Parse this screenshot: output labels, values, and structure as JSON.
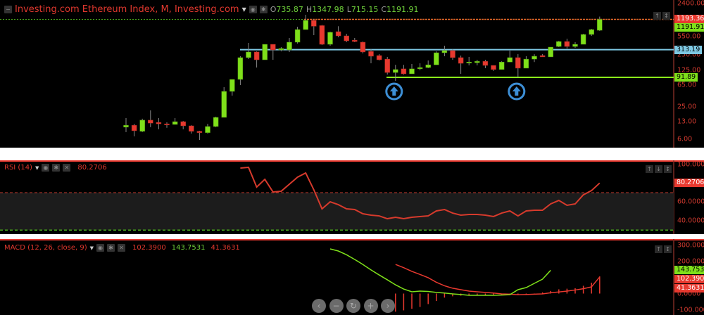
{
  "header": {
    "title": "Investing.com Ethereum Index, M, Investing.com",
    "o_label": "O",
    "o": "735.87",
    "h_label": "H",
    "h": "1347.98",
    "l_label": "L",
    "l": "715.15",
    "c_label": "C",
    "c": "1191.91"
  },
  "colors": {
    "up": "#7fe01a",
    "down": "#e8392f",
    "axis": "#d03a2f",
    "support": "#8cff1a",
    "resistance": "#7ec8e3",
    "arrow": "#3d8fd6"
  },
  "price_axis": {
    "ticks": [
      2400,
      550,
      250,
      125,
      65,
      25,
      13,
      6
    ],
    "tick_labels": [
      "2400.00",
      "550.00",
      "250.00",
      "125.00",
      "65.00",
      "25.00",
      "13.00",
      "6.00"
    ],
    "tags": [
      {
        "value": 1193.36,
        "text": "1193.36",
        "type": "red"
      },
      {
        "value": 1191.91,
        "text": "1191.91",
        "type": "green"
      },
      {
        "value": 313.19,
        "text": "313.19",
        "type": "blue"
      },
      {
        "value": 91.89,
        "text": "91.89",
        "type": "green"
      }
    ]
  },
  "levels": {
    "resistance": 313.19,
    "support": 91.89,
    "last": 1193.36
  },
  "candles": [
    [
      10.2,
      11.1,
      15.2,
      8.2
    ],
    [
      11.1,
      8.7,
      11.8,
      6.8
    ],
    [
      8.5,
      13.9,
      14.8,
      8.2
    ],
    [
      13.9,
      12.2,
      21.4,
      10.2
    ],
    [
      12.6,
      11.8,
      15.2,
      9.3
    ],
    [
      11.8,
      11.5,
      12.6,
      9.9
    ],
    [
      11.5,
      13.0,
      15.2,
      11.4
    ],
    [
      13.0,
      10.8,
      13.4,
      9.3
    ],
    [
      10.8,
      8.5,
      11.1,
      7.7
    ],
    [
      8.5,
      8.0,
      8.7,
      5.8
    ],
    [
      8.0,
      10.5,
      11.8,
      7.7
    ],
    [
      10.5,
      15.7,
      16.2,
      10.2
    ],
    [
      15.7,
      49.5,
      59.6,
      15.7
    ],
    [
      49.5,
      84,
      84,
      41.1
    ],
    [
      84,
      220,
      234,
      65.5
    ],
    [
      220,
      282,
      422,
      206
    ],
    [
      282,
      200,
      290,
      142
    ],
    [
      200,
      396,
      396,
      200
    ],
    [
      396,
      309,
      396,
      200
    ],
    [
      309,
      329,
      350,
      290
    ],
    [
      309,
      435,
      524,
      282
    ],
    [
      435,
      760,
      860,
      410
    ],
    [
      760,
      1140,
      1460,
      760
    ],
    [
      1140,
      880,
      1193,
      593
    ],
    [
      905,
      396,
      930,
      383
    ],
    [
      396,
      673,
      693,
      372
    ],
    [
      693,
      575,
      880,
      540
    ],
    [
      575,
      462,
      630,
      435
    ],
    [
      476,
      448,
      524,
      435
    ],
    [
      435,
      282,
      448,
      265
    ],
    [
      290,
      234,
      319,
      171
    ],
    [
      241,
      200,
      256,
      194
    ],
    [
      206,
      114,
      227,
      104
    ],
    [
      114,
      130,
      160,
      79
    ],
    [
      134,
      107.5,
      160,
      104
    ],
    [
      107.5,
      134,
      166,
      107.5
    ],
    [
      134,
      142,
      171,
      126
    ],
    [
      142,
      160,
      194,
      138
    ],
    [
      160,
      273,
      290,
      160
    ],
    [
      273,
      300,
      372,
      234
    ],
    [
      300,
      220,
      319,
      200
    ],
    [
      220,
      171,
      241,
      107.5
    ],
    [
      176,
      181,
      227,
      156
    ],
    [
      176,
      187,
      200,
      156
    ],
    [
      187,
      156,
      200,
      138
    ],
    [
      156,
      130,
      156,
      122
    ],
    [
      130,
      181,
      187,
      130
    ],
    [
      181,
      220,
      300,
      181
    ],
    [
      220,
      138,
      256,
      92
    ],
    [
      138,
      206,
      234,
      138
    ],
    [
      206,
      234,
      256,
      181
    ],
    [
      241,
      227,
      256,
      227
    ],
    [
      227,
      350,
      350,
      227
    ],
    [
      360,
      448,
      462,
      350
    ],
    [
      448,
      360,
      508,
      329
    ],
    [
      360,
      396,
      435,
      340
    ],
    [
      396,
      612,
      630,
      396
    ],
    [
      612,
      760,
      785,
      575
    ],
    [
      735.87,
      1191.91,
      1347.98,
      715.15
    ]
  ],
  "arrows_at": [
    33,
    48
  ],
  "rsi": {
    "label": "RSI (14)",
    "value": "80.2706",
    "overbought": 70,
    "oversold": 30,
    "start_index": 14,
    "values": [
      96.2,
      97,
      76,
      84.2,
      70.7,
      71.5,
      79,
      86.5,
      91,
      73,
      52.7,
      60.2,
      57.2,
      52.7,
      52,
      47.5,
      46,
      45.2,
      42.2,
      43.7,
      42.2,
      43.7,
      44.5,
      45.2,
      50.5,
      52,
      48.2,
      46,
      46.7,
      46.7,
      46,
      44.5,
      48.2,
      50.5,
      45.2,
      50.5,
      51.2,
      51.2,
      58,
      61.7,
      56.5,
      58,
      67.7,
      72.2,
      80.27
    ],
    "ticks": [
      100,
      60,
      40
    ],
    "tick_labels": [
      "100.0000",
      "60.0000",
      "40.0000"
    ],
    "tag": "80.2706"
  },
  "macd": {
    "label": "MACD (12, 26, close, 9)",
    "v1": "102.3900",
    "v2": "143.7531",
    "v3": "41.3631",
    "macd_start": 25,
    "macd_values": [
      276,
      263,
      240,
      211,
      180,
      146,
      115,
      85,
      54,
      28,
      11,
      15,
      13,
      7,
      3,
      -2,
      -6,
      -11,
      -11,
      -11,
      -11,
      -9,
      -7,
      24,
      37,
      63,
      89,
      143.75
    ],
    "signal_start": 33,
    "signal_values": [
      180,
      160,
      137,
      118,
      98,
      70,
      48,
      33,
      24,
      15,
      11,
      7,
      3,
      -2,
      -4,
      -7,
      -6,
      -4,
      -2,
      5,
      10,
      15,
      22,
      30,
      41.36,
      102.39
    ],
    "hist_start": 33,
    "hist_values": [
      -112,
      -104,
      -94,
      -83,
      -65,
      -46,
      -25,
      -17,
      -13,
      -13,
      -13,
      -10,
      -7,
      -7,
      -7,
      -7,
      -7,
      -4,
      7,
      16,
      26,
      30,
      33,
      48,
      67,
      106
    ],
    "ticks": [
      300,
      200,
      0,
      -100
    ],
    "tick_labels": [
      "300.0000",
      "200.0000",
      "0.0000",
      "-100.0000"
    ],
    "tags": [
      {
        "value": 143.7531,
        "text": "143.7531",
        "type": "green"
      },
      {
        "value": 102.39,
        "text": "102.3900",
        "type": "red"
      },
      {
        "value": 41.3631,
        "text": "41.3631",
        "type": "red"
      }
    ]
  },
  "nav": [
    "‹",
    "−",
    "↻",
    "+",
    "›"
  ]
}
